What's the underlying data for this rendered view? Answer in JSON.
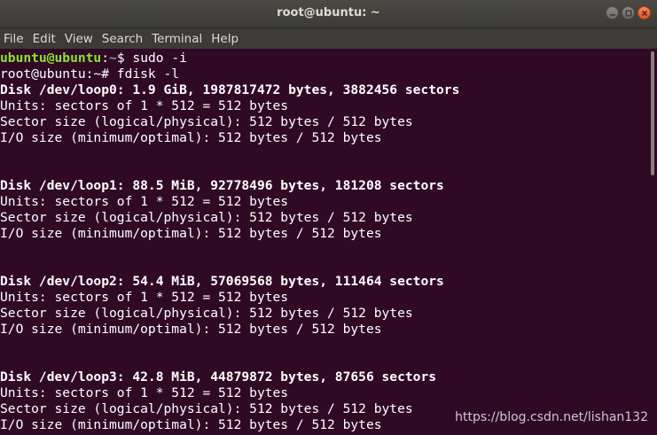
{
  "window": {
    "title": "root@ubuntu: ~"
  },
  "menu": {
    "items": [
      "File",
      "Edit",
      "View",
      "Search",
      "Terminal",
      "Help"
    ]
  },
  "terminal": {
    "prompt1": {
      "user": "ubuntu@ubuntu",
      "sep": ":",
      "path": "~",
      "symbol": "$",
      "command": " sudo -i"
    },
    "prompt2": {
      "text": "root@ubuntu:~# fdisk -l"
    },
    "disks": [
      {
        "header": "Disk /dev/loop0: 1.9 GiB, 1987817472 bytes, 3882456 sectors",
        "units": "Units: sectors of 1 * 512 = 512 bytes",
        "sector": "Sector size (logical/physical): 512 bytes / 512 bytes",
        "io": "I/O size (minimum/optimal): 512 bytes / 512 bytes"
      },
      {
        "header": "Disk /dev/loop1: 88.5 MiB, 92778496 bytes, 181208 sectors",
        "units": "Units: sectors of 1 * 512 = 512 bytes",
        "sector": "Sector size (logical/physical): 512 bytes / 512 bytes",
        "io": "I/O size (minimum/optimal): 512 bytes / 512 bytes"
      },
      {
        "header": "Disk /dev/loop2: 54.4 MiB, 57069568 bytes, 111464 sectors",
        "units": "Units: sectors of 1 * 512 = 512 bytes",
        "sector": "Sector size (logical/physical): 512 bytes / 512 bytes",
        "io": "I/O size (minimum/optimal): 512 bytes / 512 bytes"
      },
      {
        "header": "Disk /dev/loop3: 42.8 MiB, 44879872 bytes, 87656 sectors",
        "units": "Units: sectors of 1 * 512 = 512 bytes",
        "sector": "Sector size (logical/physical): 512 bytes / 512 bytes",
        "io": "I/O size (minimum/optimal): 512 bytes / 512 bytes"
      }
    ]
  },
  "watermark": "https://blog.csdn.net/lishan132",
  "colors": {
    "background": "#300a24",
    "prompt_user": "#8ae234",
    "prompt_path": "#729fcf",
    "close_button": "#e2541f"
  },
  "icons": {
    "minimize": "minimize-icon",
    "maximize": "maximize-icon",
    "close": "close-icon"
  }
}
